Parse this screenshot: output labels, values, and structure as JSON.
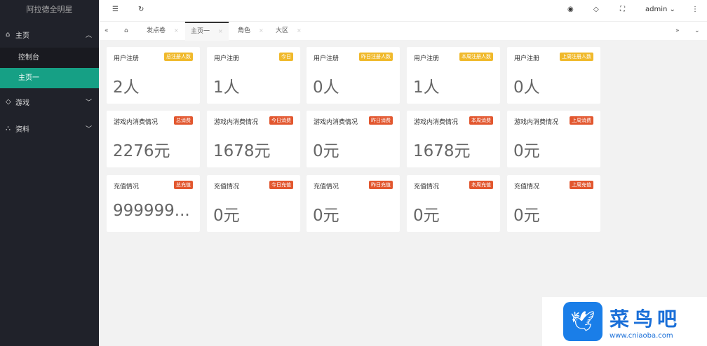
{
  "sidebar": {
    "title": "阿拉德全明星",
    "menus": [
      {
        "label": "主页",
        "icon": "home-icon",
        "expanded": true,
        "children": [
          {
            "label": "控制台"
          },
          {
            "label": "主页一",
            "active": true
          }
        ]
      },
      {
        "label": "游戏",
        "icon": "diamond-icon"
      },
      {
        "label": "资料",
        "icon": "user-icon"
      }
    ]
  },
  "header": {
    "user": "admin"
  },
  "tabs": [
    {
      "label": "发点卷"
    },
    {
      "label": "主页一",
      "active": true
    },
    {
      "label": "角色"
    },
    {
      "label": "大区"
    }
  ],
  "cards": [
    [
      {
        "title": "用户注册",
        "badge": "总注册人数",
        "value": "2人"
      },
      {
        "title": "用户注册",
        "badge": "今日",
        "value": "1人"
      },
      {
        "title": "用户注册",
        "badge": "昨日注册人数",
        "value": "0人"
      },
      {
        "title": "用户注册",
        "badge": "本周注册人数",
        "value": "1人"
      },
      {
        "title": "用户注册",
        "badge": "上周注册人数",
        "value": "0人"
      }
    ],
    [
      {
        "title": "游戏内消费情况",
        "badge": "总消费",
        "value": "2276元"
      },
      {
        "title": "游戏内消费情况",
        "badge": "今日消费",
        "value": "1678元"
      },
      {
        "title": "游戏内消费情况",
        "badge": "昨日消费",
        "value": "0元"
      },
      {
        "title": "游戏内消费情况",
        "badge": "本周消费",
        "value": "1678元"
      },
      {
        "title": "游戏内消费情况",
        "badge": "上周消费",
        "value": "0元"
      }
    ],
    [
      {
        "title": "充值情况",
        "badge": "总充值",
        "value": "999999..."
      },
      {
        "title": "充值情况",
        "badge": "今日充值",
        "value": "0元"
      },
      {
        "title": "充值情况",
        "badge": "昨日充值",
        "value": "0元"
      },
      {
        "title": "充值情况",
        "badge": "本周充值",
        "value": "0元"
      },
      {
        "title": "充值情况",
        "badge": "上周充值",
        "value": "0元"
      }
    ]
  ],
  "colors": {
    "badge_row0": "#f0b92b",
    "badge_other": "#e2572f",
    "active": "#16a085"
  },
  "watermark": {
    "name": "菜鸟吧",
    "url": "www.cniaoba.com"
  }
}
